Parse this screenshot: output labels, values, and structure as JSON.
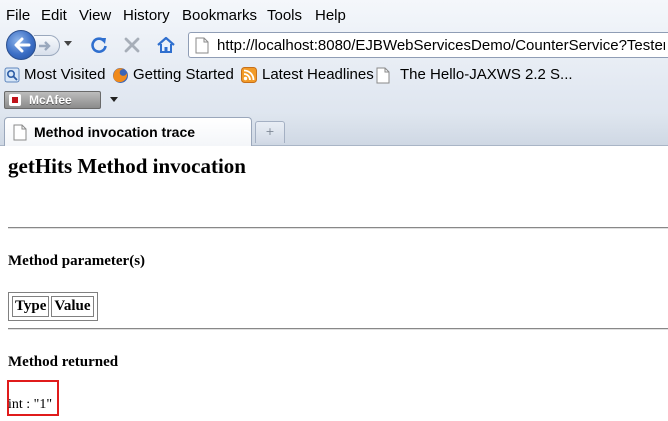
{
  "menu": [
    {
      "label": "File"
    },
    {
      "label": "Edit"
    },
    {
      "label": "View"
    },
    {
      "label": "History"
    },
    {
      "label": "Bookmarks"
    },
    {
      "label": "Tools"
    },
    {
      "label": "Help"
    }
  ],
  "address_bar": {
    "url": "http://localhost:8080/EJBWebServicesDemo/CounterService?Tester"
  },
  "bookmarks": [
    {
      "label": "Most Visited",
      "icon": "most-visited-icon"
    },
    {
      "label": "Getting Started",
      "icon": "firefox-icon"
    },
    {
      "label": "Latest Headlines",
      "icon": "rss-feed-icon"
    },
    {
      "label": "The Hello-JAXWS 2.2 S...",
      "icon": "page-icon"
    }
  ],
  "addon_bar": {
    "label": "McAfee"
  },
  "tab": {
    "title": "Method invocation trace"
  },
  "page": {
    "title": "getHits Method invocation",
    "params_heading": "Method parameter(s)",
    "params_table": {
      "headers": [
        "Type",
        "Value"
      ]
    },
    "returned_heading": "Method returned",
    "returned_value": "int : \"1\""
  },
  "colors": {
    "highlight_box": "#e01b1b",
    "back_button": "#3c6fc6"
  }
}
